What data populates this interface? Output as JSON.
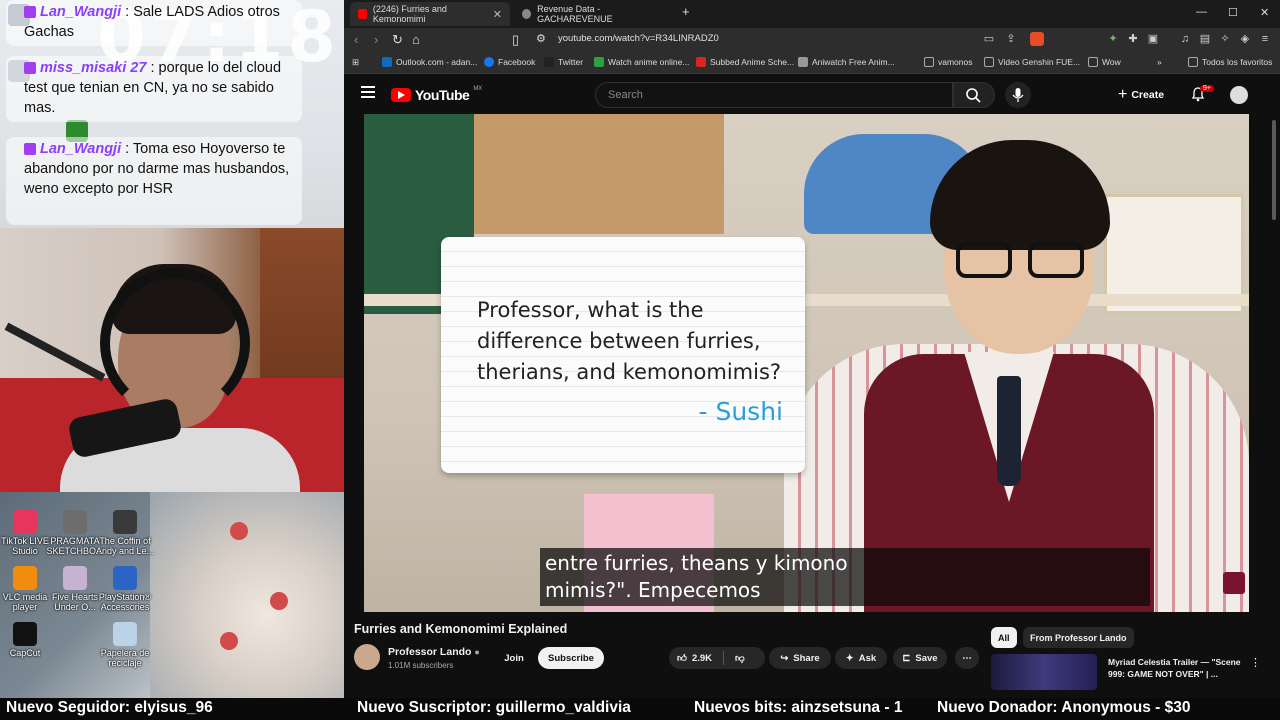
{
  "stream": {
    "clock": "07:18",
    "chat": [
      {
        "user": "Lan_Wangji",
        "text": ": Sale LADS Adios otros Gachas"
      },
      {
        "user": "miss_misaki 27",
        "text": ": porque lo del cloud test que tenian en CN, ya no se sabido mas."
      },
      {
        "user": "Lan_Wangji",
        "text": ": Toma eso Hoyoverso te abandono por no darme mas husbandos, weno excepto por HSR"
      }
    ],
    "desktop_icons": [
      {
        "label": "TikTok LIVE Studio",
        "color": "#e6365b"
      },
      {
        "label": "PRAGMATA SKETCHBO...",
        "color": "#6d6d6d"
      },
      {
        "label": "The Coffin of Andy and Le...",
        "color": "#3a3a3a"
      },
      {
        "label": "VLC media player",
        "color": "#f28c0f"
      },
      {
        "label": "Five Hearts Under O...",
        "color": "#c7b2d4"
      },
      {
        "label": "PlayStation® Accessories",
        "color": "#2a64c5"
      },
      {
        "label": "CapCut",
        "color": "#111111"
      },
      {
        "label": "Papelera de reciclaje",
        "color": "#bcd2e6"
      }
    ]
  },
  "browser": {
    "tabs": [
      {
        "label": "(2246) Furries and Kemonomimi",
        "fav": "#ff0000"
      },
      {
        "label": "Revenue Data - GACHAREVENUE",
        "fav": "#888888"
      }
    ],
    "new_tab": "+",
    "window": {
      "min": "—",
      "max": "☐",
      "close": "✕"
    },
    "url": "youtube.com/watch?v=R34LINRADZ0",
    "bookmarks": [
      {
        "label": "Outlook.com - adan...",
        "color": "#0f6cbd"
      },
      {
        "label": "Facebook",
        "color": "#1877f2"
      },
      {
        "label": "Twitter",
        "color": "#222222"
      },
      {
        "label": "Watch anime online...",
        "color": "#2ea043"
      },
      {
        "label": "Subbed Anime Sche...",
        "color": "#d22"
      },
      {
        "label": "Aniwatch Free Anim...",
        "color": "#999"
      },
      {
        "label": "vamonos",
        "color": "#aaa"
      },
      {
        "label": "Video Genshin FUE...",
        "color": "#aaa"
      },
      {
        "label": "Wow",
        "color": "#aaa"
      }
    ],
    "bookmarks_more": "»",
    "all_bookmarks": "Todos los favoritos"
  },
  "youtube": {
    "logo_text": "YouTube",
    "country": "MX",
    "search_placeholder": "Search",
    "create_label": "Create",
    "notif_count": "9+",
    "video": {
      "card_question": "Professor, what is the difference between furries, therians, and kemonomimis?",
      "card_author": "- Sushi",
      "caption_line1": "entre furries, theans y kimono",
      "caption_line2": "mimis?\".  Empecemos"
    },
    "title": "Furries and Kemonomimi Explained",
    "channel": "Professor Lando",
    "subscribers": "1.01M subscribers",
    "join_label": "Join",
    "subscribe_label": "Subscribe",
    "likes": "2.9K",
    "share_label": "Share",
    "ask_label": "Ask",
    "save_label": "Save",
    "chips": [
      "All",
      "From Professor Lando"
    ],
    "recommendation": "Myriad Celestia Trailer — \"Scene 999: GAME NOT OVER\" | ..."
  },
  "ticker": [
    "Nuevo Seguidor: elyisus_96",
    "Nuevo Suscriptor: guillermo_valdivia",
    "Nuevos bits: ainzsetsuna - 1",
    "Nuevo Donador: Anonymous - $30"
  ],
  "colors": {
    "accent_red": "#ff0000",
    "chat_user": "#8a3ffc",
    "vest": "#6b1725"
  }
}
